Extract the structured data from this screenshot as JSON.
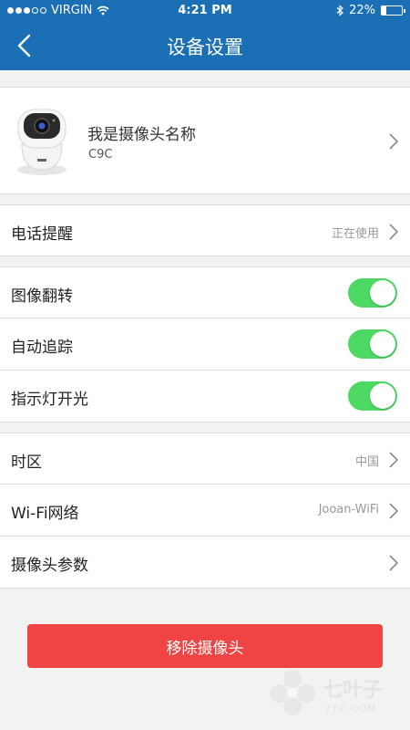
{
  "status_bar": {
    "carrier": "VIRGIN",
    "time": "4:21 PM",
    "battery": "22%",
    "battery_level": 0.22,
    "icons": [
      "signal-dots-icon",
      "wifi-icon",
      "bluetooth-icon",
      "battery-icon"
    ]
  },
  "nav": {
    "title": "设备设置",
    "back_icon": "chevron-left-icon"
  },
  "device": {
    "name": "我是摄像头名称",
    "model": "C9C",
    "image_icon": "camera-device-icon"
  },
  "settings": {
    "phone_alert": {
      "label": "电话提醒",
      "value": "正在使用"
    },
    "image_flip": {
      "label": "图像翻转",
      "on": true
    },
    "auto_tracking": {
      "label": "自动追踪",
      "on": true
    },
    "indicator_light": {
      "label": "指示灯开光",
      "on": true
    },
    "timezone": {
      "label": "时区",
      "value": "中国"
    },
    "wifi": {
      "label": "Wi-Fi网络",
      "value": "Jooan-WiFi"
    },
    "camera_params": {
      "label": "摄像头参数"
    }
  },
  "remove_button": {
    "label": "移除摄像头"
  },
  "watermark": {
    "text": "七叶子",
    "sub": "7YZ.COM"
  },
  "colors": {
    "header": "#1a6fb5",
    "toggle_on": "#4cd964",
    "remove_button": "#f04444",
    "background": "#f2f2f2"
  }
}
